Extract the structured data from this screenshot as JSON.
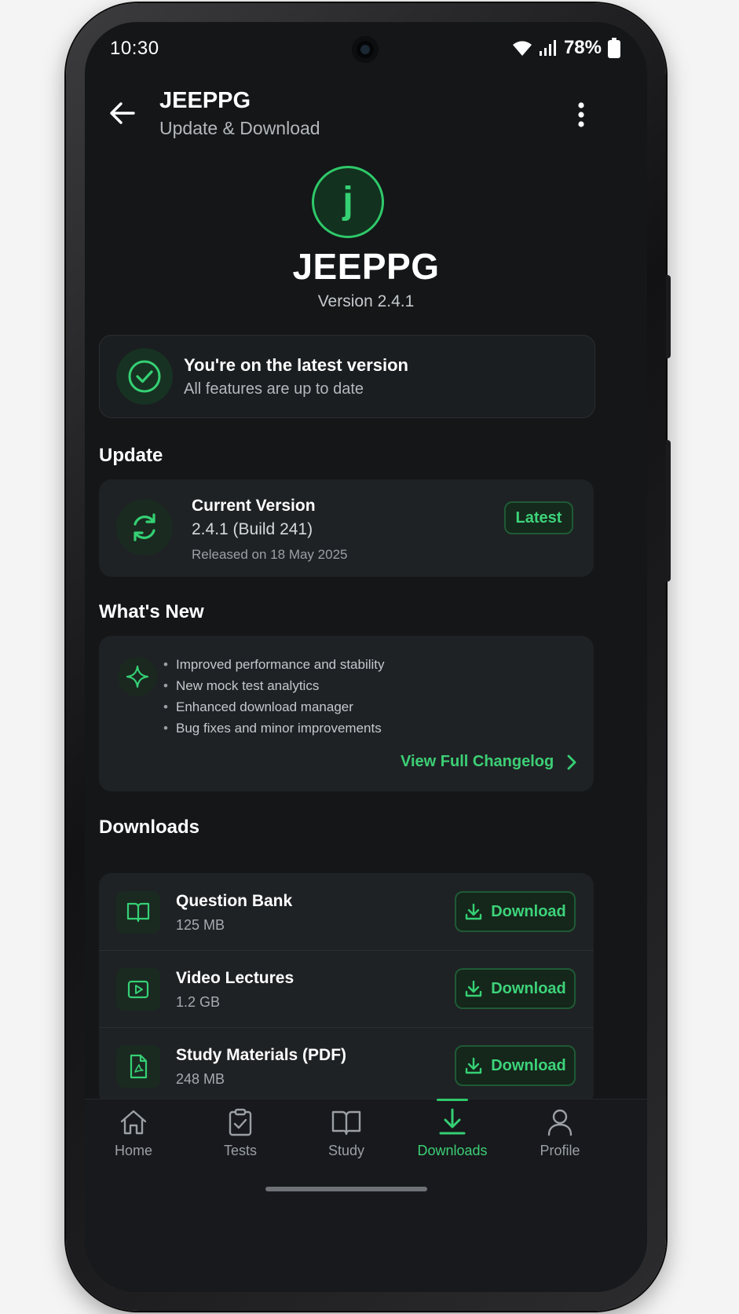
{
  "status_bar": {
    "time": "10:30",
    "battery": "78%"
  },
  "app_bar": {
    "title": "JEEPPG",
    "subtitle": "Update & Download"
  },
  "app_info": {
    "logo_letter": "j",
    "name": "JEEPPG",
    "version": "Version 2.4.1"
  },
  "status_card": {
    "title": "You're on the latest version",
    "subtitle": "All features are up to date"
  },
  "update_section": {
    "title": "Update",
    "label": "Current Version",
    "value": "2.4.1 (Build 241)",
    "released": "Released on 18 May 2025",
    "badge": "Latest"
  },
  "whats_new": {
    "title": "What's New",
    "items": [
      "Improved performance and stability",
      "New mock test analytics",
      "Enhanced download manager",
      "Bug fixes and minor improvements"
    ],
    "link": "View Full Changelog"
  },
  "downloads": {
    "title": "Downloads",
    "items": [
      {
        "name": "Question Bank",
        "size": "125 MB",
        "button": "Download",
        "icon": "book-icon"
      },
      {
        "name": "Video Lectures",
        "size": "1.2 GB",
        "button": "Download",
        "icon": "video-icon"
      },
      {
        "name": "Study Materials (PDF)",
        "size": "248 MB",
        "button": "Download",
        "icon": "pdf-icon"
      }
    ]
  },
  "bottom_nav": {
    "active": "Downloads",
    "items": [
      {
        "label": "Home",
        "icon": "home-icon"
      },
      {
        "label": "Tests",
        "icon": "tests-icon"
      },
      {
        "label": "Study",
        "icon": "study-icon"
      },
      {
        "label": "Downloads",
        "icon": "downloads-icon"
      },
      {
        "label": "Profile",
        "icon": "profile-icon"
      }
    ]
  },
  "colors": {
    "accent": "#35d074",
    "background": "#141618",
    "card": "#1f2225"
  }
}
